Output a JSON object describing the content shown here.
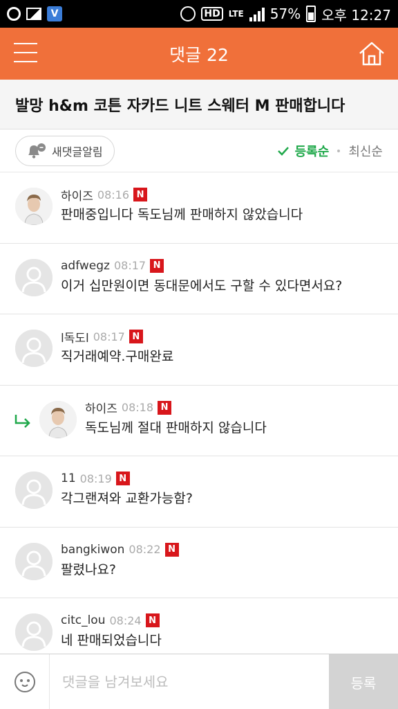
{
  "status_bar": {
    "battery": "57%",
    "time": "오후 12:27",
    "hd_label": "HD",
    "network": "LTE"
  },
  "header": {
    "title": "댓글 22"
  },
  "post": {
    "title": "발망 h&m 코튼 자카드 니트 스웨터 M 판매합니다"
  },
  "toolbar": {
    "alarm_label": "새댓글알림",
    "sort_options": [
      "등록순",
      "최신순"
    ],
    "active_sort": "등록순"
  },
  "comments": [
    {
      "author": "하이즈",
      "time": "08:16",
      "badge": "N",
      "text": "판매중입니다 독도님께 판매하지 않았습니다",
      "reply": false,
      "photo": true
    },
    {
      "author": "adfwegz",
      "time": "08:17",
      "badge": "N",
      "text": "이거 십만원이면 동대문에서도 구할 수 있다면서요?",
      "reply": false,
      "photo": false
    },
    {
      "author": "l독도l",
      "time": "08:17",
      "badge": "N",
      "text": "직거래예약.구매완료",
      "reply": false,
      "photo": false
    },
    {
      "author": "하이즈",
      "time": "08:18",
      "badge": "N",
      "text": "독도님께 절대 판매하지 않습니다",
      "reply": true,
      "photo": true
    },
    {
      "author": "11",
      "time": "08:19",
      "badge": "N",
      "text": "각그랜져와 교환가능함?",
      "reply": false,
      "photo": false
    },
    {
      "author": "bangkiwon",
      "time": "08:22",
      "badge": "N",
      "text": "팔렸나요?",
      "reply": false,
      "photo": false
    },
    {
      "author": "citc_lou",
      "time": "08:24",
      "badge": "N",
      "text": "네 판매되었습니다",
      "reply": false,
      "photo": false
    }
  ],
  "input_bar": {
    "placeholder": "댓글을 남겨보세요",
    "submit_label": "등록"
  },
  "colors": {
    "header": "#f0703a",
    "sort_active": "#1fa84a",
    "new_badge": "#d8161b"
  }
}
